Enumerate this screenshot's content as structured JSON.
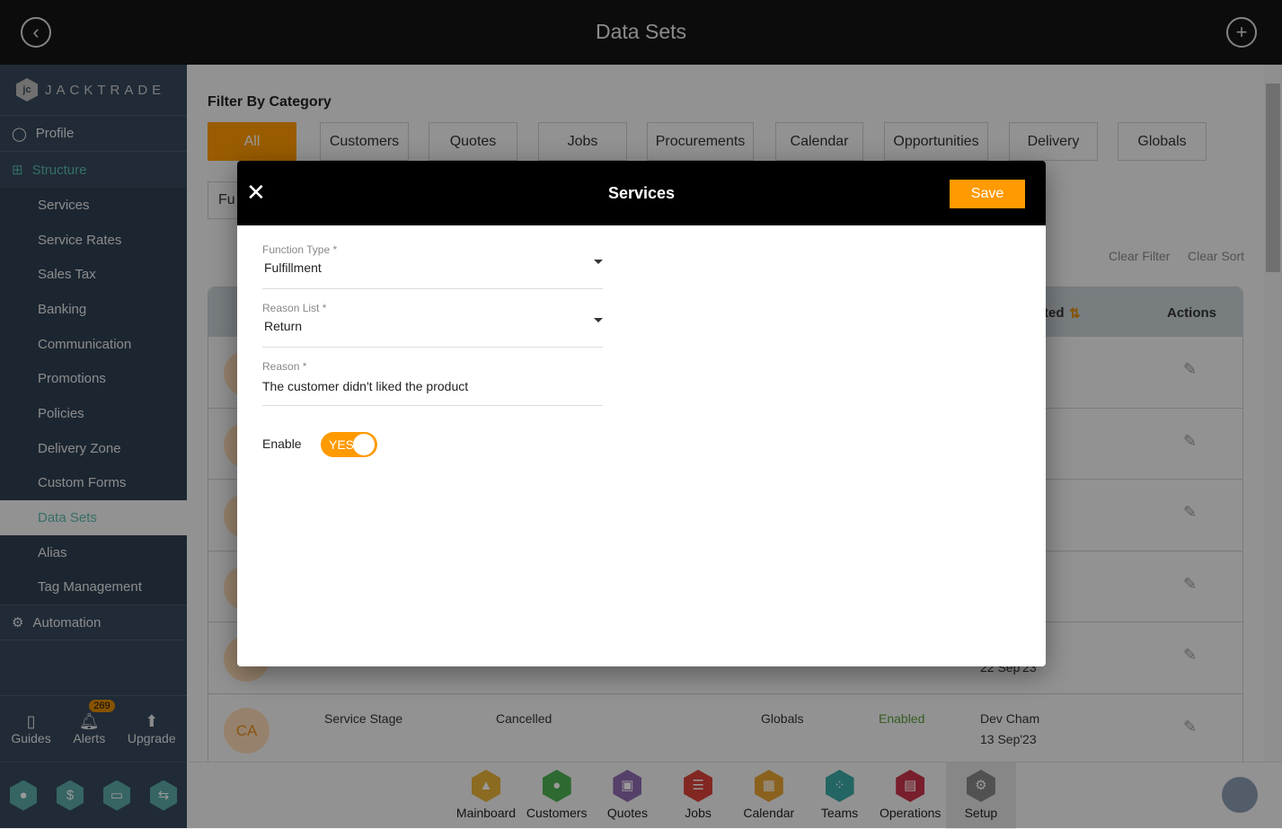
{
  "header": {
    "title": "Data Sets",
    "back_icon": "chevron-left-circle-icon",
    "add_icon": "plus-circle-icon"
  },
  "sidebar": {
    "brand": "JACKTRADE",
    "brand_tm": "™",
    "profile": "Profile",
    "structure": "Structure",
    "items": [
      "Services",
      "Service Rates",
      "Sales Tax",
      "Banking",
      "Communication",
      "Promotions",
      "Policies",
      "Delivery Zone",
      "Custom Forms",
      "Data Sets",
      "Alias",
      "Tag Management"
    ],
    "active": "Data Sets",
    "automation": "Automation",
    "bottom": {
      "guides": "Guides",
      "alerts": "Alerts",
      "alerts_count": "269",
      "upgrade": "Upgrade"
    }
  },
  "filter": {
    "label": "Filter By Category",
    "categories": [
      "All",
      "Customers",
      "Quotes",
      "Jobs",
      "Procurements",
      "Calendar",
      "Opportunities",
      "Delivery",
      "Globals"
    ],
    "active": "All",
    "function_partial": "Fu",
    "clear_filter": "Clear Filter",
    "clear_sort": "Clear Sort"
  },
  "table": {
    "header_partial": "ted",
    "actions": "Actions",
    "partial_date": "22 Sep'23",
    "last_row": {
      "avatar": "CA",
      "name": "Service Stage",
      "reason": "Cancelled",
      "category": "Globals",
      "status": "Enabled",
      "created_by": "Dev Cham",
      "created_on": "13 Sep'23"
    }
  },
  "bottom_nav": [
    "Mainboard",
    "Customers",
    "Quotes",
    "Jobs",
    "Calendar",
    "Teams",
    "Operations",
    "Setup"
  ],
  "bottom_nav_active": "Setup",
  "colors": {
    "accent": "#ff9a00",
    "teal": "#5ab7ac",
    "enabled": "#5a9a3a"
  },
  "modal": {
    "title": "Services",
    "save": "Save",
    "function_type": {
      "label": "Function Type *",
      "value": "Fulfillment"
    },
    "reason_list": {
      "label": "Reason List *",
      "value": "Return"
    },
    "reason": {
      "label": "Reason *",
      "value": "The customer didn't liked the product"
    },
    "enable": {
      "label": "Enable",
      "value": "YES",
      "on": true
    }
  }
}
